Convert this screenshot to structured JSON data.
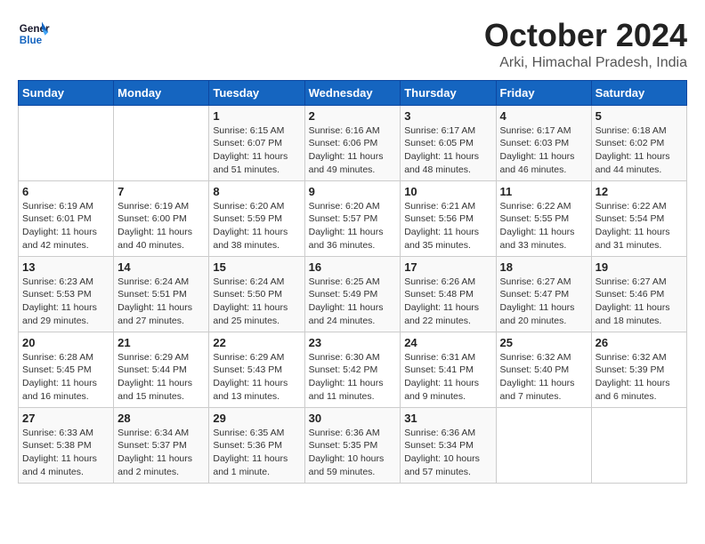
{
  "logo": {
    "line1": "General",
    "line2": "Blue"
  },
  "title": "October 2024",
  "location": "Arki, Himachal Pradesh, India",
  "days_of_week": [
    "Sunday",
    "Monday",
    "Tuesday",
    "Wednesday",
    "Thursday",
    "Friday",
    "Saturday"
  ],
  "weeks": [
    [
      {
        "day": "",
        "sunrise": "",
        "sunset": "",
        "daylight": ""
      },
      {
        "day": "",
        "sunrise": "",
        "sunset": "",
        "daylight": ""
      },
      {
        "day": "1",
        "sunrise": "Sunrise: 6:15 AM",
        "sunset": "Sunset: 6:07 PM",
        "daylight": "Daylight: 11 hours and 51 minutes."
      },
      {
        "day": "2",
        "sunrise": "Sunrise: 6:16 AM",
        "sunset": "Sunset: 6:06 PM",
        "daylight": "Daylight: 11 hours and 49 minutes."
      },
      {
        "day": "3",
        "sunrise": "Sunrise: 6:17 AM",
        "sunset": "Sunset: 6:05 PM",
        "daylight": "Daylight: 11 hours and 48 minutes."
      },
      {
        "day": "4",
        "sunrise": "Sunrise: 6:17 AM",
        "sunset": "Sunset: 6:03 PM",
        "daylight": "Daylight: 11 hours and 46 minutes."
      },
      {
        "day": "5",
        "sunrise": "Sunrise: 6:18 AM",
        "sunset": "Sunset: 6:02 PM",
        "daylight": "Daylight: 11 hours and 44 minutes."
      }
    ],
    [
      {
        "day": "6",
        "sunrise": "Sunrise: 6:19 AM",
        "sunset": "Sunset: 6:01 PM",
        "daylight": "Daylight: 11 hours and 42 minutes."
      },
      {
        "day": "7",
        "sunrise": "Sunrise: 6:19 AM",
        "sunset": "Sunset: 6:00 PM",
        "daylight": "Daylight: 11 hours and 40 minutes."
      },
      {
        "day": "8",
        "sunrise": "Sunrise: 6:20 AM",
        "sunset": "Sunset: 5:59 PM",
        "daylight": "Daylight: 11 hours and 38 minutes."
      },
      {
        "day": "9",
        "sunrise": "Sunrise: 6:20 AM",
        "sunset": "Sunset: 5:57 PM",
        "daylight": "Daylight: 11 hours and 36 minutes."
      },
      {
        "day": "10",
        "sunrise": "Sunrise: 6:21 AM",
        "sunset": "Sunset: 5:56 PM",
        "daylight": "Daylight: 11 hours and 35 minutes."
      },
      {
        "day": "11",
        "sunrise": "Sunrise: 6:22 AM",
        "sunset": "Sunset: 5:55 PM",
        "daylight": "Daylight: 11 hours and 33 minutes."
      },
      {
        "day": "12",
        "sunrise": "Sunrise: 6:22 AM",
        "sunset": "Sunset: 5:54 PM",
        "daylight": "Daylight: 11 hours and 31 minutes."
      }
    ],
    [
      {
        "day": "13",
        "sunrise": "Sunrise: 6:23 AM",
        "sunset": "Sunset: 5:53 PM",
        "daylight": "Daylight: 11 hours and 29 minutes."
      },
      {
        "day": "14",
        "sunrise": "Sunrise: 6:24 AM",
        "sunset": "Sunset: 5:51 PM",
        "daylight": "Daylight: 11 hours and 27 minutes."
      },
      {
        "day": "15",
        "sunrise": "Sunrise: 6:24 AM",
        "sunset": "Sunset: 5:50 PM",
        "daylight": "Daylight: 11 hours and 25 minutes."
      },
      {
        "day": "16",
        "sunrise": "Sunrise: 6:25 AM",
        "sunset": "Sunset: 5:49 PM",
        "daylight": "Daylight: 11 hours and 24 minutes."
      },
      {
        "day": "17",
        "sunrise": "Sunrise: 6:26 AM",
        "sunset": "Sunset: 5:48 PM",
        "daylight": "Daylight: 11 hours and 22 minutes."
      },
      {
        "day": "18",
        "sunrise": "Sunrise: 6:27 AM",
        "sunset": "Sunset: 5:47 PM",
        "daylight": "Daylight: 11 hours and 20 minutes."
      },
      {
        "day": "19",
        "sunrise": "Sunrise: 6:27 AM",
        "sunset": "Sunset: 5:46 PM",
        "daylight": "Daylight: 11 hours and 18 minutes."
      }
    ],
    [
      {
        "day": "20",
        "sunrise": "Sunrise: 6:28 AM",
        "sunset": "Sunset: 5:45 PM",
        "daylight": "Daylight: 11 hours and 16 minutes."
      },
      {
        "day": "21",
        "sunrise": "Sunrise: 6:29 AM",
        "sunset": "Sunset: 5:44 PM",
        "daylight": "Daylight: 11 hours and 15 minutes."
      },
      {
        "day": "22",
        "sunrise": "Sunrise: 6:29 AM",
        "sunset": "Sunset: 5:43 PM",
        "daylight": "Daylight: 11 hours and 13 minutes."
      },
      {
        "day": "23",
        "sunrise": "Sunrise: 6:30 AM",
        "sunset": "Sunset: 5:42 PM",
        "daylight": "Daylight: 11 hours and 11 minutes."
      },
      {
        "day": "24",
        "sunrise": "Sunrise: 6:31 AM",
        "sunset": "Sunset: 5:41 PM",
        "daylight": "Daylight: 11 hours and 9 minutes."
      },
      {
        "day": "25",
        "sunrise": "Sunrise: 6:32 AM",
        "sunset": "Sunset: 5:40 PM",
        "daylight": "Daylight: 11 hours and 7 minutes."
      },
      {
        "day": "26",
        "sunrise": "Sunrise: 6:32 AM",
        "sunset": "Sunset: 5:39 PM",
        "daylight": "Daylight: 11 hours and 6 minutes."
      }
    ],
    [
      {
        "day": "27",
        "sunrise": "Sunrise: 6:33 AM",
        "sunset": "Sunset: 5:38 PM",
        "daylight": "Daylight: 11 hours and 4 minutes."
      },
      {
        "day": "28",
        "sunrise": "Sunrise: 6:34 AM",
        "sunset": "Sunset: 5:37 PM",
        "daylight": "Daylight: 11 hours and 2 minutes."
      },
      {
        "day": "29",
        "sunrise": "Sunrise: 6:35 AM",
        "sunset": "Sunset: 5:36 PM",
        "daylight": "Daylight: 11 hours and 1 minute."
      },
      {
        "day": "30",
        "sunrise": "Sunrise: 6:36 AM",
        "sunset": "Sunset: 5:35 PM",
        "daylight": "Daylight: 10 hours and 59 minutes."
      },
      {
        "day": "31",
        "sunrise": "Sunrise: 6:36 AM",
        "sunset": "Sunset: 5:34 PM",
        "daylight": "Daylight: 10 hours and 57 minutes."
      },
      {
        "day": "",
        "sunrise": "",
        "sunset": "",
        "daylight": ""
      },
      {
        "day": "",
        "sunrise": "",
        "sunset": "",
        "daylight": ""
      }
    ]
  ]
}
